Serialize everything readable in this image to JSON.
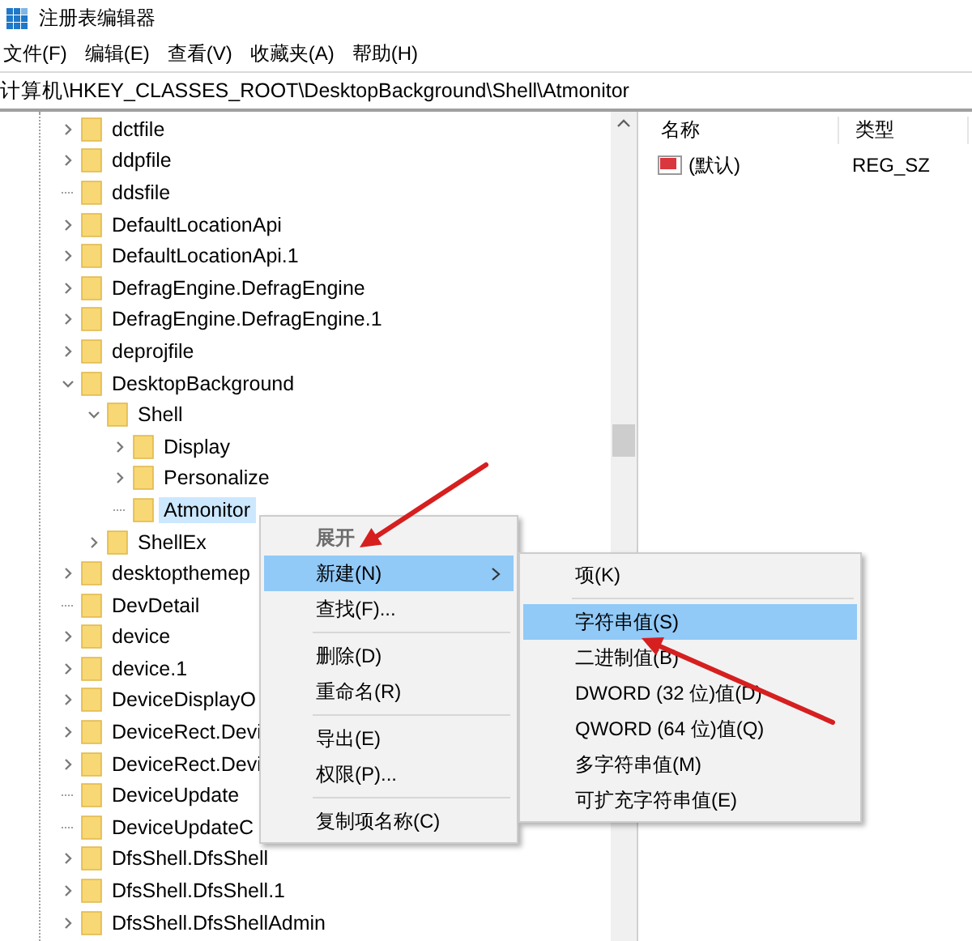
{
  "window": {
    "title": "注册表编辑器"
  },
  "menu_bar": [
    "文件(F)",
    "编辑(E)",
    "查看(V)",
    "收藏夹(A)",
    "帮助(H)"
  ],
  "address": "计算机\\HKEY_CLASSES_ROOT\\DesktopBackground\\Shell\\Atmonitor",
  "tree": [
    {
      "label": "dctfile",
      "expandable": true,
      "expanded": false,
      "selected": false
    },
    {
      "label": "ddpfile",
      "expandable": true,
      "expanded": false,
      "selected": false
    },
    {
      "label": "ddsfile",
      "expandable": false,
      "selected": false
    },
    {
      "label": "DefaultLocationApi",
      "expandable": true,
      "expanded": false,
      "selected": false
    },
    {
      "label": "DefaultLocationApi.1",
      "expandable": true,
      "expanded": false,
      "selected": false
    },
    {
      "label": "DefragEngine.DefragEngine",
      "expandable": true,
      "expanded": false,
      "selected": false
    },
    {
      "label": "DefragEngine.DefragEngine.1",
      "expandable": true,
      "expanded": false,
      "selected": false
    },
    {
      "label": "deprojfile",
      "expandable": true,
      "expanded": false,
      "selected": false
    },
    {
      "label": "DesktopBackground",
      "expandable": true,
      "expanded": true,
      "selected": false,
      "children": [
        {
          "label": "Shell",
          "expandable": true,
          "expanded": true,
          "selected": false,
          "children": [
            {
              "label": "Display",
              "expandable": true,
              "expanded": false,
              "selected": false
            },
            {
              "label": "Personalize",
              "expandable": true,
              "expanded": false,
              "selected": false
            },
            {
              "label": "Atmonitor",
              "expandable": false,
              "selected": true
            }
          ]
        },
        {
          "label": "ShellEx",
          "expandable": true,
          "expanded": false,
          "selected": false
        }
      ]
    },
    {
      "label": "desktopthemep",
      "expandable": true,
      "expanded": false,
      "selected": false
    },
    {
      "label": "DevDetail",
      "expandable": false,
      "selected": false
    },
    {
      "label": "device",
      "expandable": true,
      "expanded": false,
      "selected": false
    },
    {
      "label": "device.1",
      "expandable": true,
      "expanded": false,
      "selected": false
    },
    {
      "label": "DeviceDisplayO",
      "expandable": true,
      "expanded": false,
      "selected": false
    },
    {
      "label": "DeviceRect.Devi",
      "expandable": true,
      "expanded": false,
      "selected": false
    },
    {
      "label": "DeviceRect.Devi",
      "expandable": true,
      "expanded": false,
      "selected": false
    },
    {
      "label": "DeviceUpdate",
      "expandable": false,
      "selected": false
    },
    {
      "label": "DeviceUpdateC",
      "expandable": false,
      "selected": false
    },
    {
      "label": "DfsShell.DfsShell",
      "expandable": true,
      "expanded": false,
      "selected": false
    },
    {
      "label": "DfsShell.DfsShell.1",
      "expandable": true,
      "expanded": false,
      "selected": false
    },
    {
      "label": "DfsShell.DfsShellAdmin",
      "expandable": true,
      "expanded": false,
      "selected": false
    }
  ],
  "values_table": {
    "columns": [
      "名称",
      "类型"
    ],
    "rows": [
      {
        "name": "(默认)",
        "type": "REG_SZ"
      }
    ]
  },
  "context_menu": [
    {
      "kind": "item",
      "label": "展开",
      "default": true,
      "selected": false,
      "submenu": false
    },
    {
      "kind": "item",
      "label": "新建(N)",
      "default": false,
      "selected": true,
      "submenu": true
    },
    {
      "kind": "item",
      "label": "查找(F)...",
      "default": false,
      "selected": false,
      "submenu": false
    },
    {
      "kind": "separator"
    },
    {
      "kind": "item",
      "label": "删除(D)",
      "default": false,
      "selected": false,
      "submenu": false
    },
    {
      "kind": "item",
      "label": "重命名(R)",
      "default": false,
      "selected": false,
      "submenu": false
    },
    {
      "kind": "separator"
    },
    {
      "kind": "item",
      "label": "导出(E)",
      "default": false,
      "selected": false,
      "submenu": false
    },
    {
      "kind": "item",
      "label": "权限(P)...",
      "default": false,
      "selected": false,
      "submenu": false
    },
    {
      "kind": "separator"
    },
    {
      "kind": "item",
      "label": "复制项名称(C)",
      "default": false,
      "selected": false,
      "submenu": false
    }
  ],
  "submenu": [
    {
      "kind": "item",
      "label": "项(K)",
      "selected": false
    },
    {
      "kind": "separator"
    },
    {
      "kind": "item",
      "label": "字符串值(S)",
      "selected": true
    },
    {
      "kind": "item",
      "label": "二进制值(B)",
      "selected": false
    },
    {
      "kind": "item",
      "label": "DWORD (32 位)值(D)",
      "selected": false
    },
    {
      "kind": "item",
      "label": "QWORD (64 位)值(Q)",
      "selected": false
    },
    {
      "kind": "item",
      "label": "多字符串值(M)",
      "selected": false
    },
    {
      "kind": "item",
      "label": "可扩充字符串值(E)",
      "selected": false
    }
  ]
}
